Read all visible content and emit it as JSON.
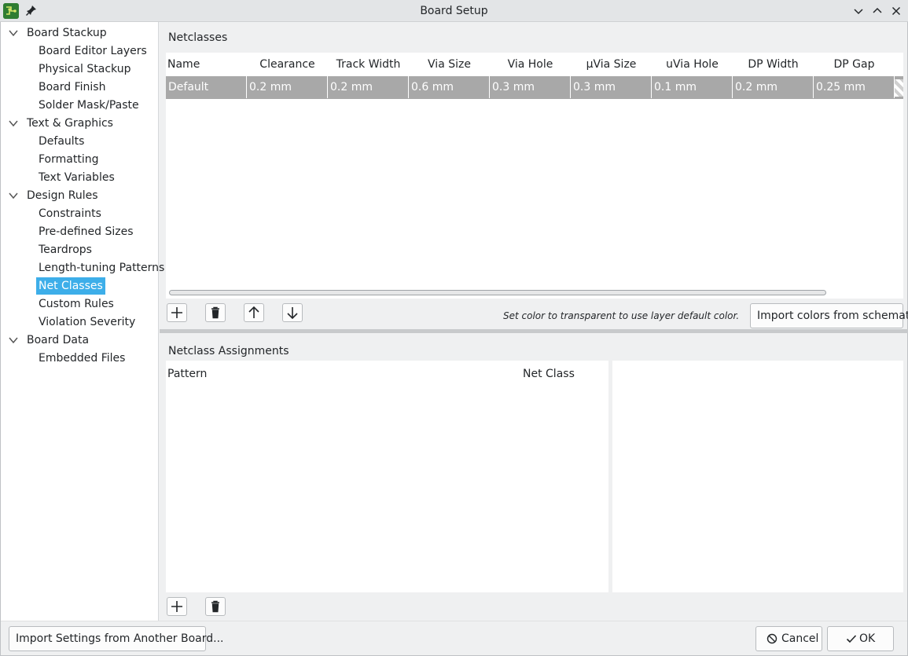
{
  "window": {
    "title": "Board Setup"
  },
  "icons": {
    "app": "pcb-icon",
    "pin": "pin-icon",
    "minimize": "chevron-down-icon",
    "maximize": "chevron-up-icon",
    "close": "close-icon"
  },
  "colors": {
    "accent": "#3daee9",
    "selected_row": "#a8a8a8"
  },
  "sidebar": {
    "groups": [
      {
        "label": "Board Stackup",
        "items": [
          "Board Editor Layers",
          "Physical Stackup",
          "Board Finish",
          "Solder Mask/Paste"
        ]
      },
      {
        "label": "Text & Graphics",
        "items": [
          "Defaults",
          "Formatting",
          "Text Variables"
        ]
      },
      {
        "label": "Design Rules",
        "items": [
          "Constraints",
          "Pre-defined Sizes",
          "Teardrops",
          "Length-tuning Patterns",
          "Net Classes",
          "Custom Rules",
          "Violation Severity"
        ]
      },
      {
        "label": "Board Data",
        "items": [
          "Embedded Files"
        ]
      }
    ],
    "selected": "Net Classes"
  },
  "netclasses": {
    "section_label": "Netclasses",
    "columns": [
      "Name",
      "Clearance",
      "Track Width",
      "Via Size",
      "Via Hole",
      "μVia Size",
      "uVia Hole",
      "DP Width",
      "DP Gap"
    ],
    "rows": [
      [
        "Default",
        "0.2 mm",
        "0.2 mm",
        "0.6 mm",
        "0.3 mm",
        "0.3 mm",
        "0.1 mm",
        "0.2 mm",
        "0.25 mm"
      ]
    ],
    "hint": "Set color to transparent to use layer default color.",
    "import_colors_label": "Import colors from schematic"
  },
  "assignments": {
    "section_label": "Netclass Assignments",
    "columns": [
      "Pattern",
      "Net Class"
    ]
  },
  "footer": {
    "import_settings_label": "Import Settings from Another Board...",
    "cancel_label": "Cancel",
    "ok_label": "OK"
  }
}
